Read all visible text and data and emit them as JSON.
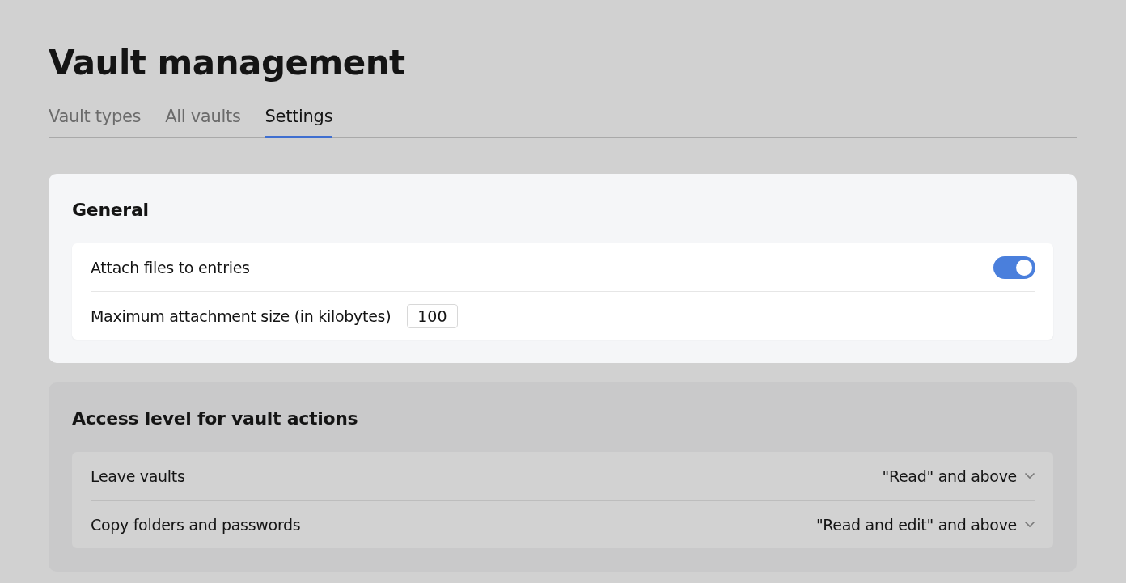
{
  "page_title": "Vault management",
  "tabs": [
    {
      "label": "Vault types",
      "selected": false
    },
    {
      "label": "All vaults",
      "selected": false
    },
    {
      "label": "Settings",
      "selected": true
    }
  ],
  "sections": [
    {
      "title": "General",
      "disabled": false,
      "rows": [
        {
          "kind": "toggle",
          "label": "Attach files to entries",
          "on": true
        },
        {
          "kind": "number",
          "label": "Maximum attachment size (in kilobytes)",
          "value": "100"
        }
      ]
    },
    {
      "title": "Access level for vault actions",
      "disabled": true,
      "rows": [
        {
          "kind": "select",
          "label": "Leave vaults",
          "value": "\"Read\" and above"
        },
        {
          "kind": "select",
          "label": "Copy folders and passwords",
          "value": "\"Read and edit\" and above"
        }
      ]
    }
  ]
}
